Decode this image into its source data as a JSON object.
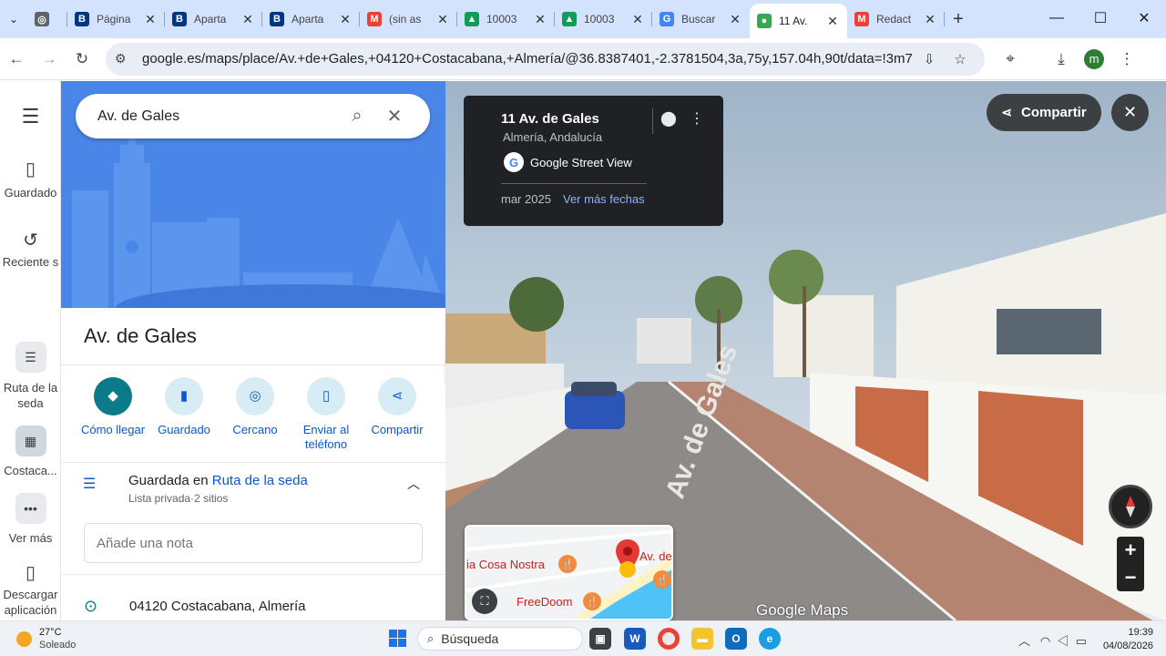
{
  "browser": {
    "tabs": [
      {
        "label": "",
        "icon": "openai-icon",
        "color": "#5f6368"
      },
      {
        "label": "Página",
        "icon": "booking-icon",
        "color": "#003580"
      },
      {
        "label": "Aparta",
        "icon": "booking-icon",
        "color": "#003580"
      },
      {
        "label": "Aparta",
        "icon": "booking-icon",
        "color": "#003580"
      },
      {
        "label": "(sin as",
        "icon": "gmail-icon",
        "color": "#ea4335"
      },
      {
        "label": "10003",
        "icon": "drive-icon",
        "color": "#0f9d58"
      },
      {
        "label": "10003",
        "icon": "drive-icon",
        "color": "#0f9d58"
      },
      {
        "label": "Buscar",
        "icon": "google-icon",
        "color": "#4285f4"
      },
      {
        "label": "11 Av.",
        "icon": "maps-pin-icon",
        "color": "#34a853"
      },
      {
        "label": "Redact",
        "icon": "gmail-icon",
        "color": "#ea4335"
      }
    ],
    "url": "google.es/maps/place/Av.+de+Gales,+04120+Costacabana,+Almería/@36.8387401,-2.3781504,3a,75y,157.04h,90t/data=!3m7!1e1!3...",
    "profile_initial": "m"
  },
  "rail": {
    "saved": "Guardado",
    "recents": "Reciente s",
    "route_list": "Ruta de la seda",
    "costacabana": "Costaca...",
    "more": "Ver más",
    "download": "Descargar aplicación"
  },
  "panel": {
    "search_value": "Av. de Gales",
    "place_title": "Av. de Gales",
    "actions": [
      {
        "label": "Cómo llegar",
        "icon": "directions-icon"
      },
      {
        "label": "Guardado",
        "icon": "bookmark-icon"
      },
      {
        "label": "Cercano",
        "icon": "nearby-icon"
      },
      {
        "label": "Enviar al teléfono",
        "icon": "send-to-phone-icon"
      },
      {
        "label": "Compartir",
        "icon": "share-icon"
      }
    ],
    "saved_in_prefix": "Guardada en",
    "saved_in_list": "Ruta de la seda",
    "saved_sub": "Lista privada·2 sitios",
    "note_placeholder": "Añade una nota",
    "address": "04120 Costacabana, Almería"
  },
  "streetview": {
    "card_title": "11 Av. de Gales",
    "card_region": "Almería, Andalucía",
    "card_source": "Google Street View",
    "card_date": "mar 2025",
    "card_more_dates": "Ver más fechas",
    "share_label": "Compartir",
    "road_text": "Av. de Gales",
    "minimap": {
      "place1": "ia Cosa Nostra",
      "place2": "FreeDoom",
      "place3": "Av. de"
    },
    "watermark": "Google Maps",
    "zoom_in": "+",
    "zoom_out": "−"
  },
  "taskbar": {
    "temp": "27°C",
    "condition": "Soleado",
    "search": "Búsqueda",
    "time": "19:39",
    "date": "04/08/2026"
  }
}
